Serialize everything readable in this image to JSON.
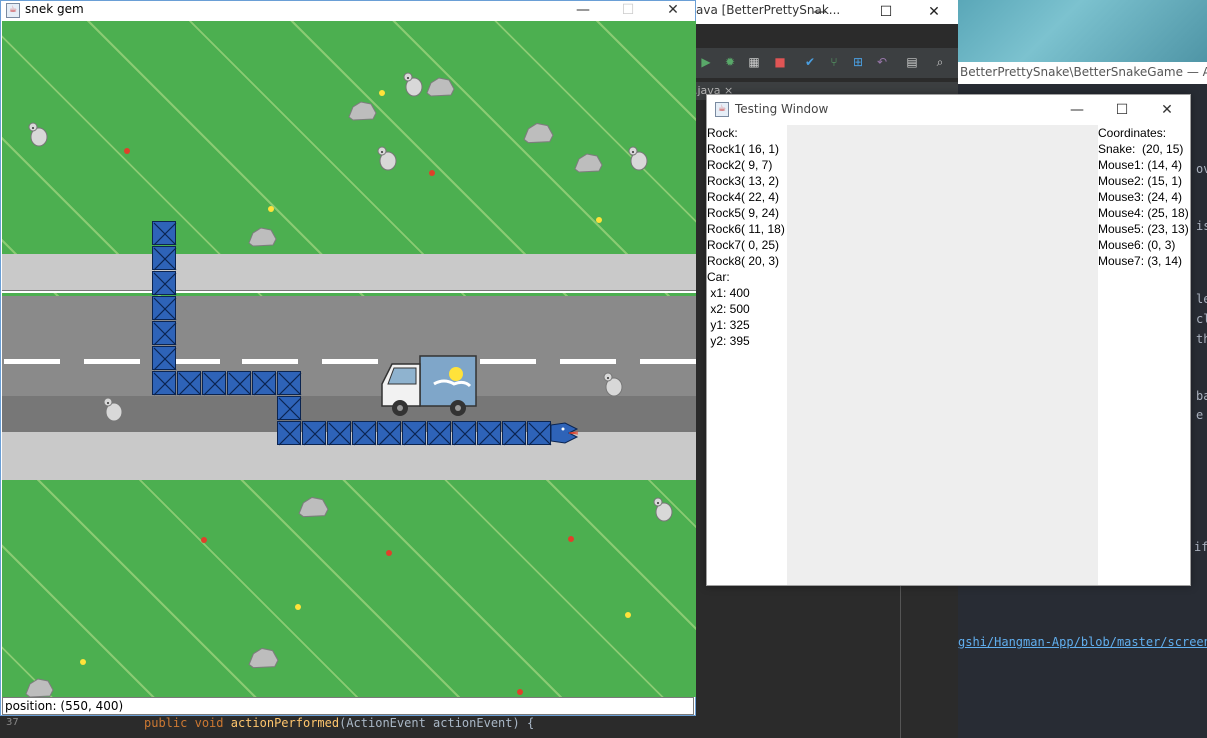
{
  "ide": {
    "title": "ava [BetterPrettySnak...",
    "tab": ".java",
    "tab_close": "×",
    "controls": {
      "minimize": "—",
      "maximize": "☐",
      "close": "✕"
    }
  },
  "atom": {
    "title": "BetterPrettySnake\\BetterSnakeGame — Atom",
    "fragments": [
      "ove",
      "is",
      "lec",
      "cl",
      "th",
      "bas",
      "e t",
      "if",
      "gshi/Hangman-App/blob/master/screens"
    ]
  },
  "bottom_code": {
    "line_number": "37",
    "kw1": "public",
    "kw2": "void",
    "fn": "actionPerformed",
    "rest": "(ActionEvent actionEvent) {"
  },
  "snake_window": {
    "title": "snek gem",
    "icon_text": "☕",
    "controls": {
      "minimize": "—",
      "maximize": "☐",
      "close": "✕"
    },
    "status": "position: (550, 400)"
  },
  "testing_window": {
    "title": "Testing Window",
    "icon_text": "☕",
    "controls": {
      "minimize": "—",
      "maximize": "☐",
      "close": "✕"
    },
    "left_col": [
      "Rock:",
      "Rock1( 16, 1)",
      "Rock2( 9, 7)",
      "Rock3( 13, 2)",
      "Rock4( 22, 4)",
      "Rock5( 9, 24)",
      "Rock6( 11, 18)",
      "Rock7( 0, 25)",
      "Rock8( 20, 3)",
      "Car:",
      " x1: 400",
      " x2: 500",
      " y1: 325",
      " y2: 395"
    ],
    "right_col": [
      "Coordinates:",
      "Snake:  (20, 15)",
      "Mouse1: (14, 4)",
      "Mouse2: (15, 1)",
      "Mouse3: (24, 4)",
      "Mouse4: (25, 18)",
      "Mouse5: (23, 13)",
      "Mouse6: (0, 3)",
      "Mouse7: (3, 14)"
    ]
  },
  "colors": {
    "grass": "#4caf50",
    "snake": "#2e63b8",
    "road": "#8a8a8a"
  }
}
